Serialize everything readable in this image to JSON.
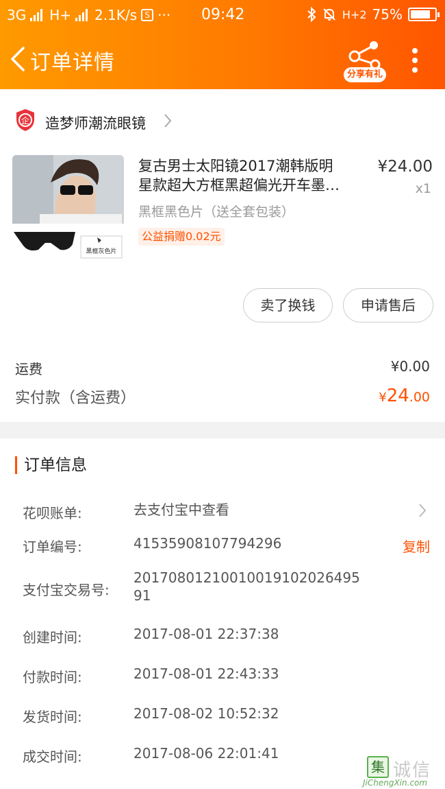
{
  "status_bar": {
    "network": "3G",
    "network2": "H+",
    "speed": "2.1K/s",
    "s_icon_label": "S",
    "dots": "···",
    "time": "09:42",
    "net_right": "H+2",
    "battery": "75%"
  },
  "nav": {
    "back_icon": "chevron-left-icon",
    "title": "订单详情",
    "share_label": "分享有礼",
    "more_icon": "vertical-dots-icon"
  },
  "shop": {
    "logo_text": "企",
    "name": "造梦师潮流眼镜"
  },
  "item": {
    "title_line1": "复古男士太阳镜2017潮韩版明",
    "title_line2": "星款超大方框黑超偏光开车墨…",
    "price": "¥24.00",
    "quantity": "x1",
    "sku": "黑框黑色片（送全套包装）",
    "charity_tag": "公益捐赠0.02元",
    "image_caption": "黑框灰色片"
  },
  "actions": {
    "sell_label": "卖了换钱",
    "after_sale_label": "申请售后"
  },
  "summary": {
    "shipping_label": "运费",
    "shipping_value": "¥0.00",
    "paid_label": "实付款（含运费）",
    "paid_currency": "¥",
    "paid_int": "24",
    "paid_dec": ".00"
  },
  "order_info": {
    "title": "订单信息",
    "huabei_label": "花呗账单:",
    "huabei_value": "去支付宝中查看",
    "order_no_label": "订单编号:",
    "order_no_value": "41535908107794296",
    "copy_label": "复制",
    "alipay_label": "支付宝交易号:",
    "alipay_value": "20170801210010019102026495 91",
    "created_label": "创建时间:",
    "created_value": "2017-08-01 22:37:38",
    "paid_time_label": "付款时间:",
    "paid_time_value": "2017-08-01 22:43:33",
    "shipped_label": "发货时间:",
    "shipped_value": "2017-08-02 10:52:32",
    "done_label": "成交时间:",
    "done_value": "2017-08-06 22:01:41"
  },
  "watermark": {
    "box_char": "集",
    "text": "诚信",
    "url": "JiChengXin.com"
  },
  "colors": {
    "brand_orange": "#ff5000",
    "header_gradient_start": "#ff9a00",
    "header_gradient_end": "#ff5500"
  }
}
